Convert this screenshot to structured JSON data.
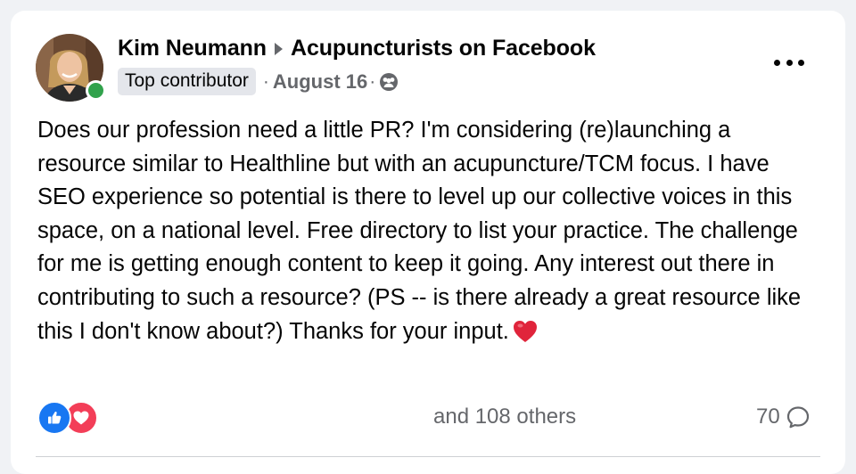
{
  "post": {
    "author": "Kim Neumann",
    "group": "Acupuncturists on Facebook",
    "badge": "Top contributor",
    "date": "August 16",
    "sep1": "·",
    "sep2": "·",
    "body": "Does our profession need a little PR? I'm considering (re)launching a resource similar to Healthline but with an acupuncture/TCM focus. I have SEO experience so potential is there to level up our collective voices in this space, on a national level. Free directory to list your practice. The challenge for me is getting enough content to keep it going. Any interest out there in contributing to such a resource? (PS -- is there already a great resource like this I don't know about?) Thanks for your input.",
    "audience_icon": "group-audience-icon",
    "online_status_color": "#31a24c"
  },
  "footer": {
    "reactions": [
      "like-icon",
      "love-icon"
    ],
    "others_text": "and 108 others",
    "comment_count": "70",
    "comment_icon": "comment-bubble-icon"
  },
  "colors": {
    "like": "#1877f2",
    "love": "#f33e58",
    "secondary_text": "#65676b",
    "badge_bg": "#e4e6eb"
  }
}
